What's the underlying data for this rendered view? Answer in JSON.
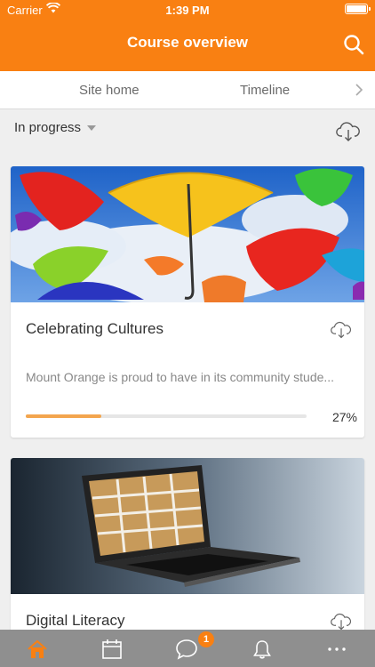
{
  "status_bar": {
    "carrier": "Carrier",
    "time": "1:39 PM"
  },
  "header": {
    "title": "Course overview",
    "search_icon": "search-icon"
  },
  "tabs": [
    {
      "label": "Site home"
    },
    {
      "label": "Timeline"
    }
  ],
  "filter": {
    "selected": "In progress"
  },
  "courses": [
    {
      "name": "Celebrating Cultures",
      "summary": "Mount Orange is proud to have in its community stude...",
      "progress_percent": 27,
      "progress_label": "27%",
      "image": "colorful-umbrellas"
    },
    {
      "name": "Digital Literacy",
      "image": "laptop-with-bookshelf"
    }
  ],
  "tabbar": {
    "items": [
      "home",
      "calendar",
      "messages",
      "notifications",
      "more"
    ],
    "active": "home",
    "messages_badge": "1"
  },
  "colors": {
    "brand": "#f98012",
    "tabbar": "#8f8f8f",
    "progress": "#f3a54e"
  }
}
